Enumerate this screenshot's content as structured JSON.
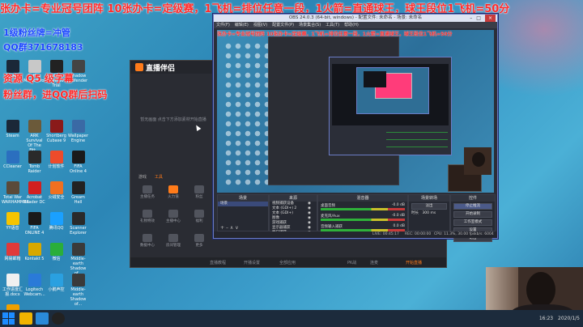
{
  "overlay": {
    "banner": "张办卡=专业冠号团阵 10张办卡=定级赛，1飞机=排位任意一段，1火箭=直通球王，球王段位1飞机=50分",
    "fans_line": "1级粉丝牌=冲管",
    "qq_line": "QQ群371678183",
    "sub_line_1": "资源   Q5 级字幕",
    "sub_line_2": "粉丝群，进QQ群后扫码"
  },
  "desktop_icons": [
    {
      "label": "Steam",
      "color": "#1b2838"
    },
    {
      "label": "Saffire MixControl",
      "color": "#c8c8c8"
    },
    {
      "label": "Ableton Live 10 Trial",
      "color": "#222"
    },
    {
      "label": "Shadow Defender",
      "color": "#444"
    },
    {
      "label": "Steam",
      "color": "#1b2838"
    },
    {
      "label": "ARK Survival Of The Fitt...",
      "color": "#6b5a3a"
    },
    {
      "label": "Shortberg Cubase 9",
      "color": "#8a1a1a"
    },
    {
      "label": "Wallpaper Engine",
      "color": "#3a6aa5"
    },
    {
      "label": "CCleaner",
      "color": "#2b6fbf"
    },
    {
      "label": "Tomb Raider",
      "color": "#2a2a2a"
    },
    {
      "label": "计划软件",
      "color": "#ee4b2b"
    },
    {
      "label": "FIFA Online 4",
      "color": "#1a1a1a"
    },
    {
      "label": "Total War WARHAMMER",
      "color": "#5a4a3a"
    },
    {
      "label": "Acrobat Reader DC",
      "color": "#d21f1f"
    },
    {
      "label": "火绒安全",
      "color": "#f07020"
    },
    {
      "label": "Gream Hell",
      "color": "#222"
    },
    {
      "label": "YY语音",
      "color": "#f5c400"
    },
    {
      "label": "FIFA ONLINE 4",
      "color": "#1a1a1a"
    },
    {
      "label": "腾讯QQ",
      "color": "#1aa0ff"
    },
    {
      "label": "Scanner Explorer",
      "color": "#2a2a2a"
    },
    {
      "label": "网易邮箱",
      "color": "#e03a3a"
    },
    {
      "label": "Kontakt 5",
      "color": "#d8a800"
    },
    {
      "label": "微信",
      "color": "#2aae3a"
    },
    {
      "label": "Middle-earth Shadow of...",
      "color": "#3a3a3a"
    },
    {
      "label": "工作进度汇报.docx",
      "color": "#f0f0f0"
    },
    {
      "label": "Logitech Webcam...",
      "color": "#2a7ad8"
    },
    {
      "label": "小鹅声控",
      "color": "#2aa0e0"
    },
    {
      "label": "Middle-earth Shadow of...",
      "color": "#3a3a3a"
    },
    {
      "label": "虎牙直播",
      "color": "#f0a000"
    }
  ],
  "live_app": {
    "title": "直播伴侣",
    "empty_preview": "暂无画面 点击下方添加素材开始直播",
    "tabs": [
      "游戏",
      "工具"
    ],
    "tools": [
      "主播任务",
      "火力值",
      "粉丝",
      "礼物特效",
      "主播中心",
      "福利",
      "数据中心",
      "房间管理",
      "更多"
    ],
    "bottom_items": [
      "直播教程",
      "开播设置",
      "全部应用",
      "PK战",
      "连麦",
      "开始直播"
    ]
  },
  "obs": {
    "title": "OBS 24.0.3 (64-bit, windows) - 配置文件: 未命名 - 场景: 未命名",
    "menu": [
      "文件(F)",
      "编辑(E)",
      "视图(V)",
      "配置文件(P)",
      "场景集合(S)",
      "工具(T)",
      "帮助(H)"
    ],
    "docks": {
      "scenes": {
        "title": "场景",
        "items": [
          "场景"
        ]
      },
      "sources": {
        "title": "来源",
        "items": [
          "视频捕获设备",
          "文本 (GDI+) 2",
          "文本 (GDI+)",
          "图像",
          "游戏捕获",
          "显示器捕获",
          "窗口捕获"
        ]
      },
      "mixer": {
        "title": "混音器",
        "channels": [
          {
            "name": "桌面音频",
            "db": "-0.0 dB"
          },
          {
            "name": "麦克风/Aux",
            "db": "-0.0 dB"
          },
          {
            "name": "音频输入捕获",
            "db": "0.0 dB"
          }
        ]
      },
      "transitions": {
        "title": "场景转场",
        "value": "淡出",
        "duration_label": "时长",
        "duration": "300 ms"
      },
      "controls": {
        "title": "控件",
        "buttons": [
          "停止推流",
          "开始录制",
          "工作室模式",
          "设置",
          "退出"
        ]
      }
    },
    "status": {
      "live": "LIVE: 00:45:17",
      "rec": "REC: 00:00:00",
      "cpu": "CPU: 11.3%, 30.00 fps",
      "kbps": "kb/s: 6004"
    }
  },
  "taskbar": {
    "time": "16:23",
    "date": "2020/1/5",
    "apps": [
      "start",
      "app-8",
      "app-calendar",
      "app-obs",
      "app-fifa",
      "app-ball",
      "app-live"
    ]
  },
  "colors": {
    "banner": "#ff2a2a",
    "accent": "#ff7b1a",
    "obs_border": "#6b7cc6"
  }
}
